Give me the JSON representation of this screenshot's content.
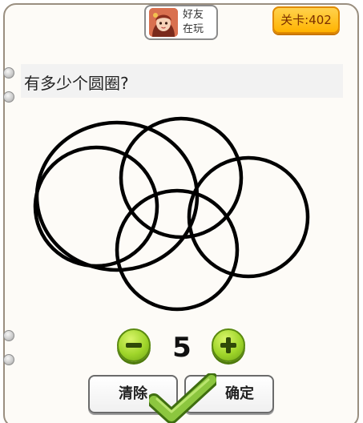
{
  "header": {
    "friend_line1": "好友",
    "friend_line2": "在玩",
    "level_label": "关卡:402"
  },
  "question": {
    "text": "有多少个圆圈?"
  },
  "counter": {
    "value": "5",
    "decrement_icon": "minus-icon",
    "increment_icon": "plus-icon"
  },
  "actions": {
    "clear_label": "清除",
    "confirm_label": "确定"
  },
  "puzzle": {
    "circle_count": 5
  },
  "colors": {
    "level_badge": "#ffb300",
    "counter_buttons": "#9fd52a",
    "checkmark": "#8cc63f",
    "circle_stroke": "#000000"
  }
}
